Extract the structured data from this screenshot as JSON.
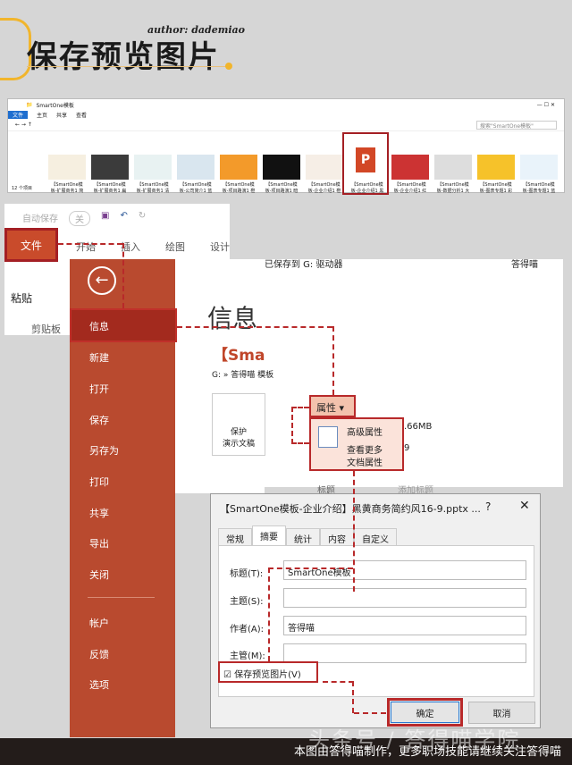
{
  "header": {
    "title": "保存预览图片",
    "author": "author: dademiao"
  },
  "explorer": {
    "window_title": "SmartOne模板",
    "menu": [
      "文件",
      "主页",
      "共享",
      "查看"
    ],
    "search_placeholder": "搜索\"SmartOne模板\"",
    "status": "12 个项目",
    "files": [
      "【SmartOne模板-扩展商务1 简",
      "【SmartOne模板-扩展商务1 扁",
      "【SmartOne模板-扩展商务1 清",
      "【SmartOne模板-公司简介1 蓝",
      "【SmartOne模板-项目路演1 橙",
      "【SmartOne模板-项目路演1 暗",
      "【SmartOne模板-企业介绍1 橙",
      "【SmartOne模板-企业介绍1 黑",
      "【SmartOne模板-企业介绍1 红",
      "【SmartOne模板-数据分析1 大",
      "【SmartOne模板-图表专题1 彩",
      "【SmartOne模板-图表专题1 蓝"
    ]
  },
  "ribbon": {
    "autosave": "自动保存",
    "autosave_state": "关",
    "file_tab": "文件",
    "tabs": [
      "开始",
      "插入",
      "绘图",
      "设计"
    ],
    "paste": "粘贴",
    "clipboard": "剪贴板"
  },
  "backstage": {
    "items": [
      "信息",
      "新建",
      "打开",
      "保存",
      "另存为",
      "打印",
      "共享",
      "导出",
      "关闭",
      "帐户",
      "反馈",
      "选项"
    ],
    "info_title": "信息",
    "file_name": "【Sma",
    "path": "G: » 答得喵 模板",
    "protect": "保护",
    "protect_sub": "演示文稿",
    "saved_to": "已保存到 G: 驱动器",
    "user": "答得喵",
    "properties": "属性",
    "adv_props": "高级属性",
    "more_props": "查看更多",
    "more_props2": "文档属性",
    "size": ".66MB",
    "count": "9",
    "title_label": "标题",
    "add_title": "添加标题"
  },
  "dialog": {
    "title": "【SmartOne模板-企业介绍】黑黄商务简约风16-9.pptx ...",
    "help": "?",
    "close": "✕",
    "tabs": [
      "常规",
      "摘要",
      "统计",
      "内容",
      "自定义"
    ],
    "fields": [
      {
        "label": "标题(T):",
        "value": "SmartOne模板"
      },
      {
        "label": "主题(S):",
        "value": ""
      },
      {
        "label": "作者(A):",
        "value": "答得喵"
      },
      {
        "label": "主管(M):",
        "value": ""
      }
    ],
    "checkbox": "保存预览图片(V)",
    "ok": "确定",
    "cancel": "取消"
  },
  "footer": {
    "text": "本图由答得喵制作，更多职场技能请继续关注答得喵",
    "watermark": "头条号 / 答得喵学院"
  }
}
